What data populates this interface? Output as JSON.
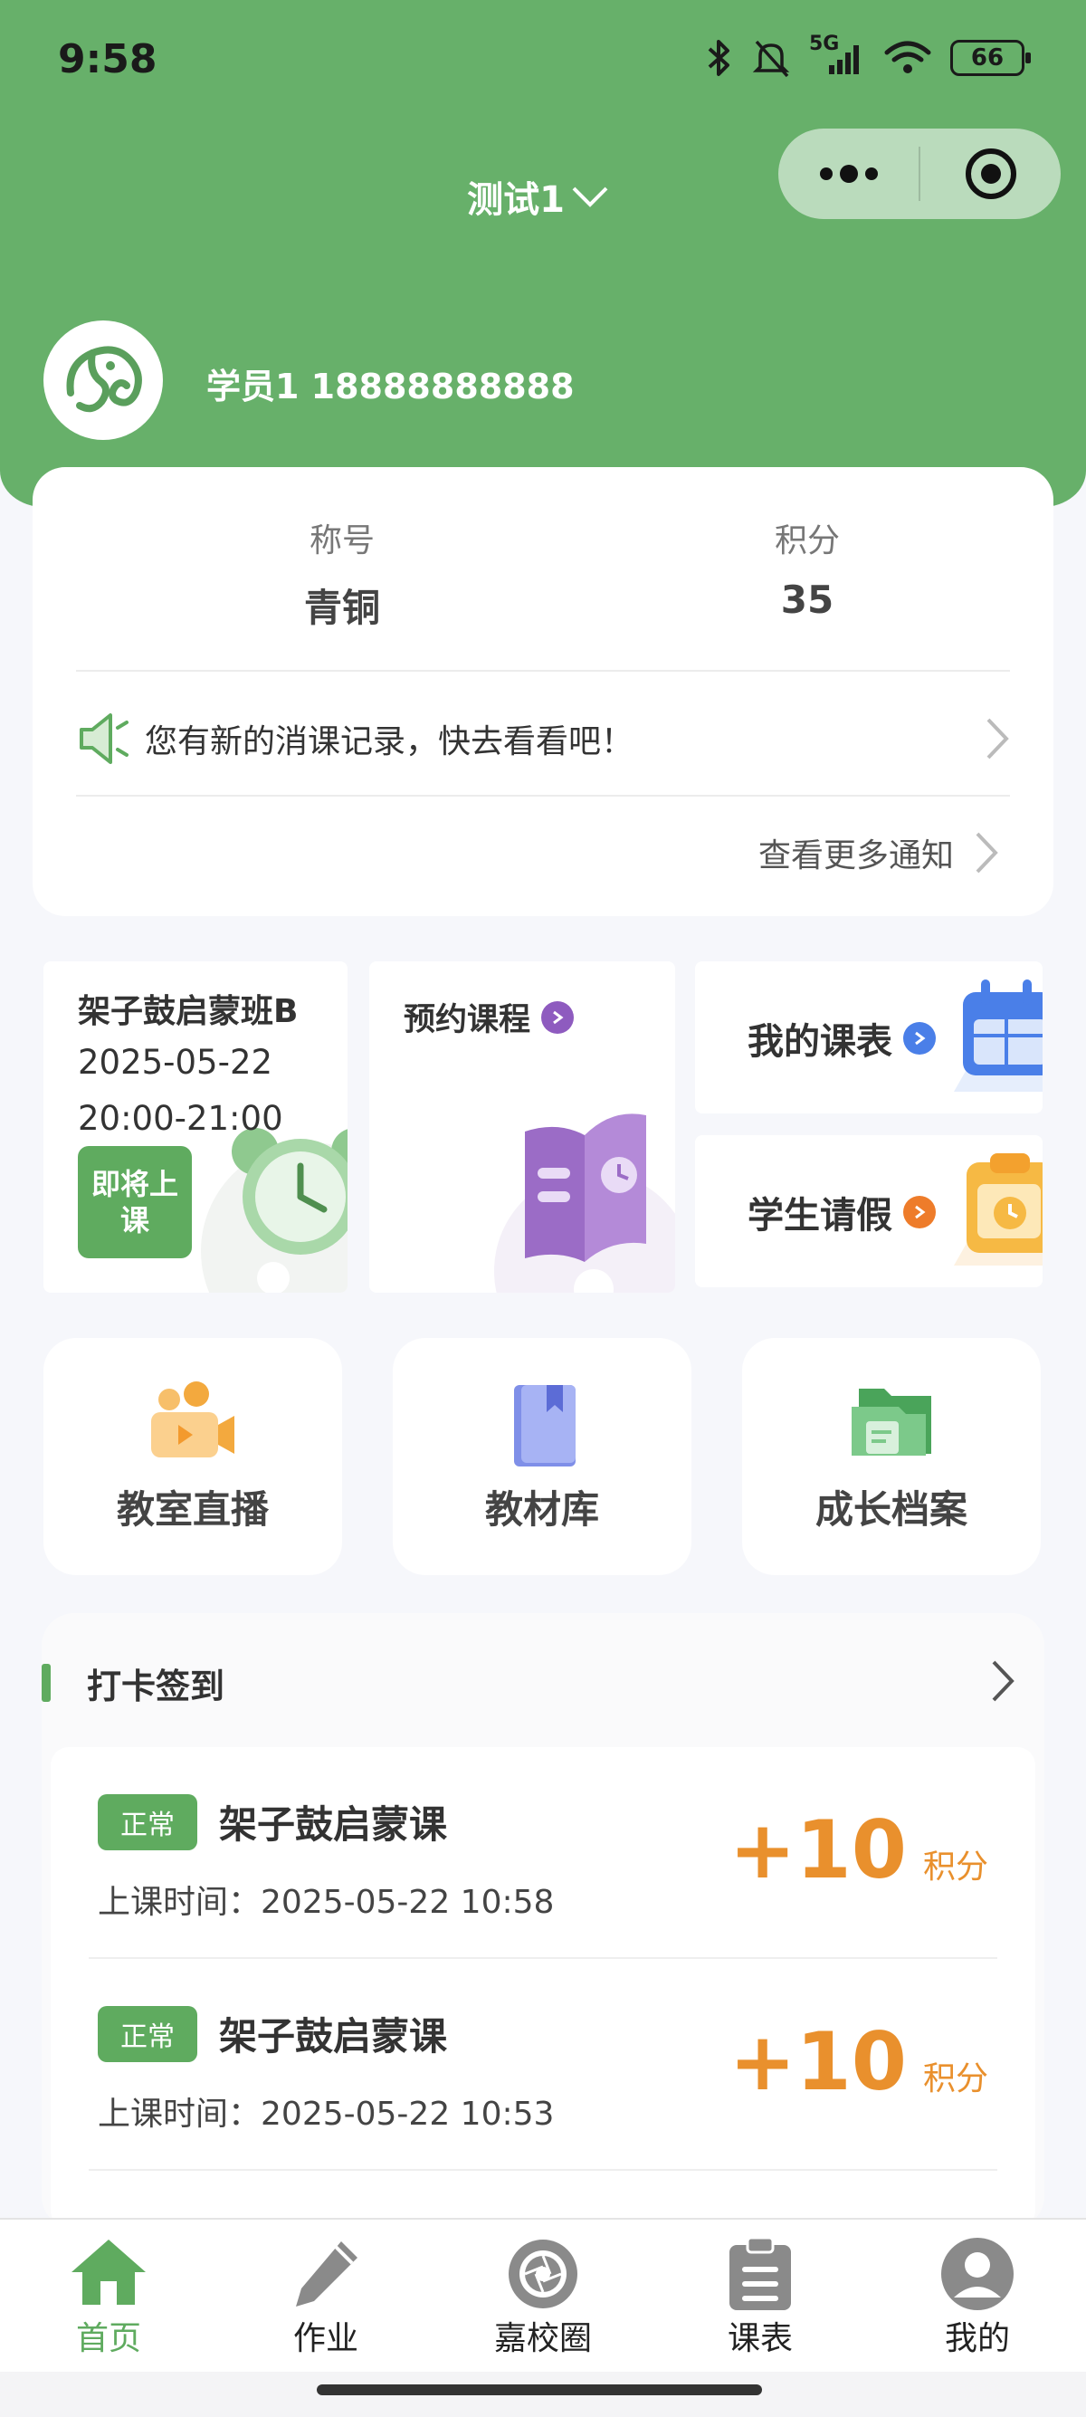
{
  "status_bar": {
    "time": "9:58",
    "battery": "66",
    "network": "5G"
  },
  "header": {
    "org_title": "测试1",
    "user_text": "学员1 18888888888"
  },
  "profile": {
    "title_label": "称号",
    "title_value": "青铜",
    "points_label": "积分",
    "points_value": "35",
    "notice": "您有新的消课记录，快去看看吧！",
    "more_notices": "查看更多通知"
  },
  "tiles": {
    "course": {
      "name": "架子鼓启蒙班B",
      "date": "2025-05-22",
      "time": "20:00-21:00",
      "status": "即将上课"
    },
    "book_course": "预约课程",
    "my_schedule": "我的课表",
    "student_leave": "学生请假"
  },
  "features": [
    {
      "label": "教室直播",
      "icon": "video-camera-icon"
    },
    {
      "label": "教材库",
      "icon": "book-icon"
    },
    {
      "label": "成长档案",
      "icon": "folder-icon"
    }
  ],
  "checkin": {
    "title": "打卡签到",
    "records": [
      {
        "status": "正常",
        "course": "架子鼓启蒙课",
        "time_label": "上课时间：",
        "time": "2025-05-22 10:58",
        "points": "+10",
        "unit": "积分"
      },
      {
        "status": "正常",
        "course": "架子鼓启蒙课",
        "time_label": "上课时间：",
        "time": "2025-05-22 10:53",
        "points": "+10",
        "unit": "积分"
      }
    ]
  },
  "tabbar": [
    {
      "label": "首页",
      "icon": "home-icon",
      "active": true
    },
    {
      "label": "作业",
      "icon": "pencil-icon",
      "active": false
    },
    {
      "label": "嘉校圈",
      "icon": "aperture-icon",
      "active": false
    },
    {
      "label": "课表",
      "icon": "clipboard-icon",
      "active": false
    },
    {
      "label": "我的",
      "icon": "user-icon",
      "active": false
    }
  ],
  "colors": {
    "primary_green": "#67b06a",
    "accent_orange": "#e9902d",
    "purple": "#8e5bbf",
    "blue": "#4a7fe8"
  }
}
